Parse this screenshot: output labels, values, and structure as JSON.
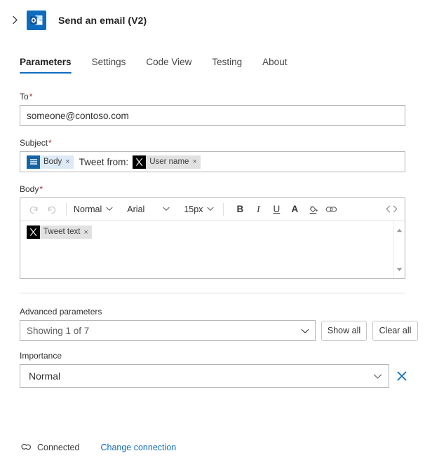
{
  "header": {
    "expand_icon": "chevron-right-icon",
    "app_icon": "outlook-icon",
    "title": "Send an email (V2)"
  },
  "tabs": [
    {
      "label": "Parameters",
      "active": true
    },
    {
      "label": "Settings",
      "active": false
    },
    {
      "label": "Code View",
      "active": false
    },
    {
      "label": "Testing",
      "active": false
    },
    {
      "label": "About",
      "active": false
    }
  ],
  "fields": {
    "to": {
      "label": "To",
      "required": "*",
      "value": "someone@contoso.com"
    },
    "subject": {
      "label": "Subject",
      "required": "*",
      "token_body": "Body",
      "token_body_remove": "×",
      "static_text": "Tweet from:",
      "token_user": "User name",
      "token_user_remove": "×"
    },
    "body": {
      "label": "Body",
      "required": "*",
      "token_tweet": "Tweet text",
      "token_tweet_remove": "×"
    }
  },
  "toolbar": {
    "undo": "undo-icon",
    "redo": "redo-icon",
    "style": "Normal",
    "font": "Arial",
    "size": "15px",
    "bold": "B",
    "italic": "I",
    "underline": "U",
    "font_color": "A",
    "highlight": "highlight-icon",
    "link": "link-icon",
    "code": "<>"
  },
  "advanced": {
    "label": "Advanced parameters",
    "value": "Showing 1 of 7",
    "show_all": "Show all",
    "clear_all": "Clear all"
  },
  "importance": {
    "label": "Importance",
    "value": "Normal",
    "clear_icon": "close-icon"
  },
  "footer": {
    "status_icon": "link-connected-icon",
    "status": "Connected",
    "link": "Change connection"
  },
  "colors": {
    "accent": "#0F6CBD",
    "required": "#a4262c",
    "token_body_bg": "#dceaf7",
    "token_grey_bg": "#e1e1e1",
    "x_logo_bg": "#000000"
  }
}
